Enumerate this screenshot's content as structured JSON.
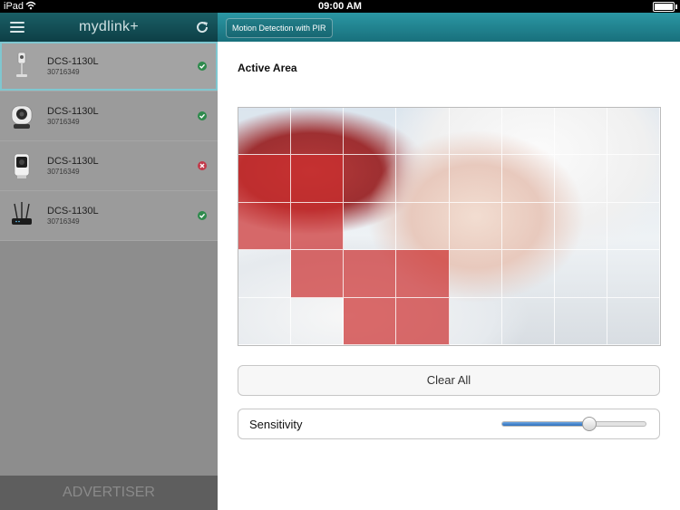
{
  "status_bar": {
    "carrier": "iPad",
    "time": "09:00 AM"
  },
  "sidebar": {
    "brand": "mydlink+",
    "devices": [
      {
        "name": "DCS-1130L",
        "serial": "30716349",
        "status": "ok",
        "icon": "camera-small-icon"
      },
      {
        "name": "DCS-1130L",
        "serial": "30716349",
        "status": "ok",
        "icon": "camera-pt-icon"
      },
      {
        "name": "DCS-1130L",
        "serial": "30716349",
        "status": "error",
        "icon": "camera-cube-icon"
      },
      {
        "name": "DCS-1130L",
        "serial": "30716349",
        "status": "ok",
        "icon": "router-icon"
      }
    ],
    "footer": "ADVERTISER"
  },
  "panel": {
    "tab_label": "Motion Detection with PIR",
    "section_title": "Active Area",
    "active_grid": [
      [
        0,
        0,
        0,
        0,
        0,
        0,
        0,
        0
      ],
      [
        1,
        1,
        0,
        0,
        0,
        0,
        0,
        0
      ],
      [
        1,
        1,
        0,
        0,
        0,
        0,
        0,
        0
      ],
      [
        0,
        1,
        1,
        1,
        0,
        0,
        0,
        0
      ],
      [
        0,
        0,
        1,
        1,
        0,
        0,
        0,
        0
      ]
    ],
    "clear_label": "Clear All",
    "sensitivity_label": "Sensitivity",
    "sensitivity_value": 0.6
  },
  "colors": {
    "accent": "#1f7f8b",
    "active_cell": "#cc2d2d",
    "ok": "#2e8a4c",
    "error": "#c23a4a"
  }
}
